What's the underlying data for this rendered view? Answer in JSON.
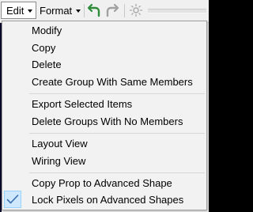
{
  "toolbar": {
    "edit_label": "Edit",
    "format_label": "Format"
  },
  "menu": {
    "items": [
      {
        "label": "Modify"
      },
      {
        "label": "Copy"
      },
      {
        "label": "Delete"
      },
      {
        "label": "Create Group With Same Members"
      },
      {
        "label": "Export Selected Items"
      },
      {
        "label": "Delete Groups With No Members"
      },
      {
        "label": "Layout View"
      },
      {
        "label": "Wiring View"
      },
      {
        "label": "Copy Prop to Advanced Shape"
      },
      {
        "label": "Lock Pixels on Advanced Shapes",
        "checked": true
      }
    ]
  },
  "icons": {
    "undo": "undo-icon",
    "redo": "redo-icon",
    "brightness": "brightness-icon",
    "check": "check-icon"
  },
  "colors": {
    "undo_green": "#2e8b3a",
    "redo_gray": "#9a9a9a",
    "check_blue": "#3c6fb0",
    "checked_bg": "#cde8ff"
  }
}
